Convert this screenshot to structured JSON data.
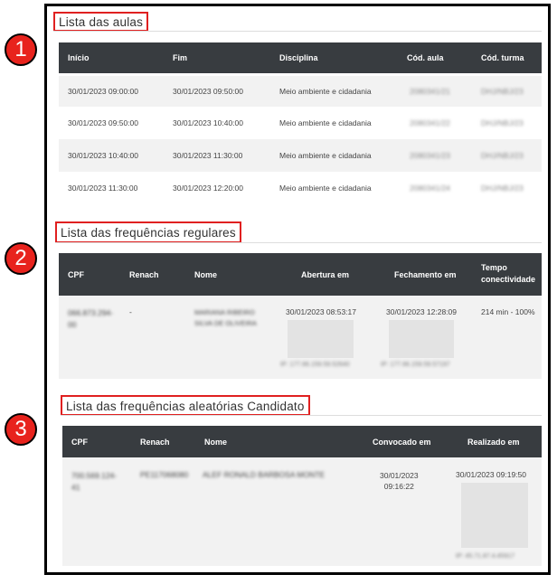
{
  "badges": [
    "1",
    "2",
    "3"
  ],
  "section1": {
    "title": "Lista das aulas",
    "headers": [
      "Início",
      "Fim",
      "Disciplina",
      "Cód. aula",
      "Cód. turma"
    ],
    "rows": [
      [
        "30/01/2023 09:00:00",
        "30/01/2023 09:50:00",
        "Meio ambiente e cidadania",
        "2080341/21",
        "DHJ/NBJ/23"
      ],
      [
        "30/01/2023 09:50:00",
        "30/01/2023 10:40:00",
        "Meio ambiente e cidadania",
        "2080341/22",
        "DHJ/NBJ/23"
      ],
      [
        "30/01/2023 10:40:00",
        "30/01/2023 11:30:00",
        "Meio ambiente e cidadania",
        "2080341/23",
        "DHJ/NBJ/23"
      ],
      [
        "30/01/2023 11:30:00",
        "30/01/2023 12:20:00",
        "Meio ambiente e cidadania",
        "2080341/24",
        "DHJ/NBJ/23"
      ]
    ]
  },
  "section2": {
    "title": "Lista das frequências regulares",
    "headers": [
      "CPF",
      "Renach",
      "Nome",
      "Abertura em",
      "Fechamento em",
      "Tempo",
      "conectividade"
    ],
    "row": {
      "cpf_line1": "066.873.294-",
      "cpf_line2": "00",
      "renach": "-",
      "nome_line1": "MARIANA RIBEIRO",
      "nome_line2": "SILVA DE OLIVEIRA",
      "abertura": "30/01/2023 08:53:17",
      "fechamento": "30/01/2023 12:28:09",
      "tempo": "214 min - 100%",
      "ip1": "IP: 177.66.159.59.52640",
      "ip2": "IP: 177.66.159.59.57197"
    }
  },
  "section3": {
    "title": "Lista das frequências aleatórias Candidato",
    "headers": [
      "CPF",
      "Renach",
      "Nome",
      "Convocado em",
      "Realizado em"
    ],
    "row": {
      "cpf_line1": "700.569.124-",
      "cpf_line2": "41",
      "renach": "PE117068080",
      "nome": "ALEF RONALD BARBOSA MONTE",
      "convocado_line1": "30/01/2023",
      "convocado_line2": "09:16:22",
      "realizado": "30/01/2023 09:19:50",
      "ip": "IP: 45.71.87.4.45917"
    }
  }
}
